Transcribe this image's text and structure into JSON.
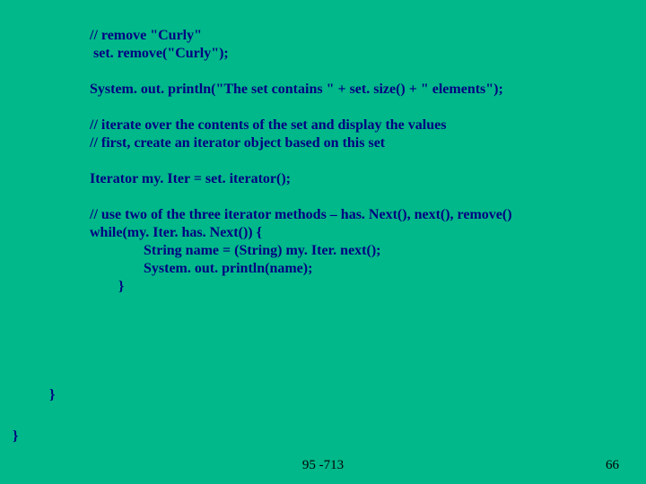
{
  "code": {
    "l01": "// remove \"Curly\"",
    "l02": " set. remove(\"Curly\");",
    "l03": "System. out. println(\"The set contains \" + set. size() + \" elements\");",
    "l04": "// iterate over the contents of the set and display the values",
    "l05": "// first, create an iterator object based on this set",
    "l06": "Iterator my. Iter = set. iterator();",
    "l07": "// use two of the three iterator methods – has. Next(), next(), remove()",
    "l08": "while(my. Iter. has. Next()) {",
    "l09": "               String name = (String) my. Iter. next();",
    "l10": "               System. out. println(name);",
    "l11": "        }"
  },
  "braces": {
    "b1": "}",
    "b2": "}"
  },
  "footer": {
    "center": "95 -713",
    "page": "66"
  }
}
